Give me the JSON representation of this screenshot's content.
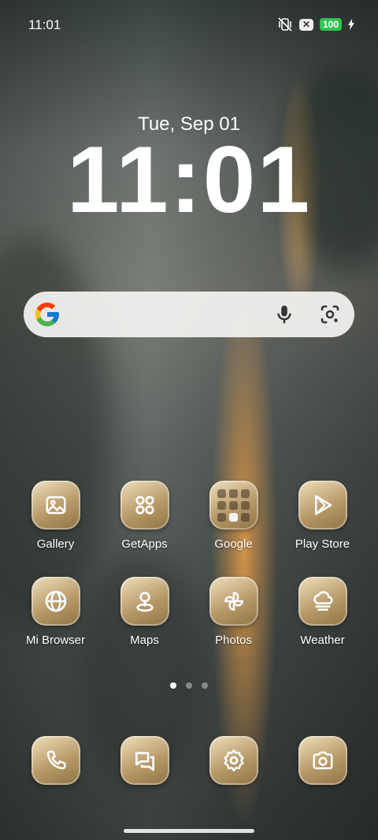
{
  "status_bar": {
    "time": "11:01",
    "battery": "100"
  },
  "lock": {
    "date": "Tue, Sep 01",
    "time": "11:01"
  },
  "apps": [
    {
      "label": "Gallery",
      "icon": "gallery-icon"
    },
    {
      "label": "GetApps",
      "icon": "getapps-icon"
    },
    {
      "label": "Google",
      "icon": "folder-icon"
    },
    {
      "label": "Play Store",
      "icon": "play-store-icon"
    },
    {
      "label": "Mi Browser",
      "icon": "globe-icon"
    },
    {
      "label": "Maps",
      "icon": "map-pin-icon"
    },
    {
      "label": "Photos",
      "icon": "pinwheel-icon"
    },
    {
      "label": "Weather",
      "icon": "cloud-fog-icon"
    }
  ],
  "dock": [
    {
      "name": "phone-icon"
    },
    {
      "name": "messages-icon"
    },
    {
      "name": "settings-icon"
    },
    {
      "name": "camera-icon"
    }
  ],
  "colors": {
    "battery": "#2fc44f",
    "tile_light": "#efe0bd",
    "tile_dark": "#8f7344"
  }
}
